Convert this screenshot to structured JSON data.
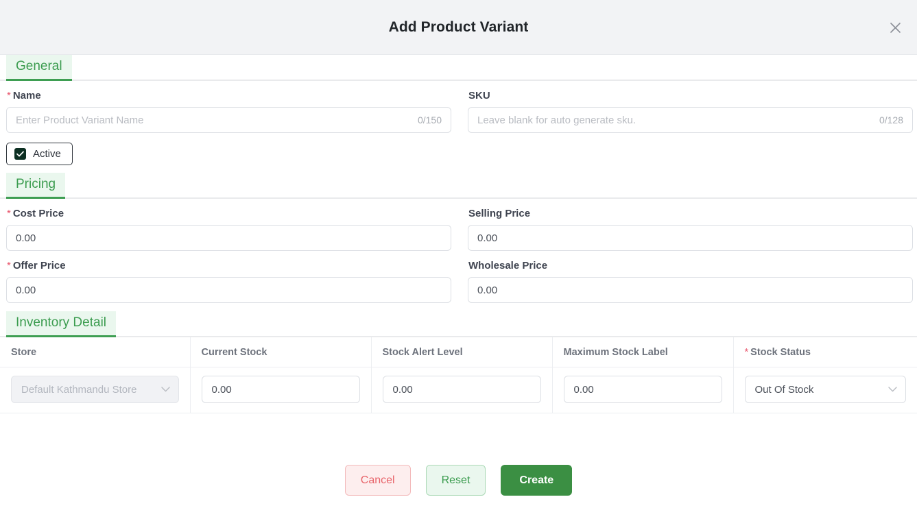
{
  "header": {
    "title": "Add Product Variant",
    "close_icon": "close-icon"
  },
  "sections": {
    "general": {
      "tab_label": "General",
      "name": {
        "label": "Name",
        "required": true,
        "required_mark": "*",
        "placeholder": "Enter Product Variant Name",
        "value": "",
        "counter": "0/150"
      },
      "sku": {
        "label": "SKU",
        "required": false,
        "placeholder": "Leave blank for auto generate sku.",
        "value": "",
        "counter": "0/128"
      },
      "active": {
        "label": "Active",
        "checked": true,
        "icon": "check-icon"
      }
    },
    "pricing": {
      "tab_label": "Pricing",
      "cost_price": {
        "label": "Cost Price",
        "required": true,
        "required_mark": "*",
        "value": "0.00"
      },
      "selling_price": {
        "label": "Selling Price",
        "required": false,
        "value": "0.00"
      },
      "offer_price": {
        "label": "Offer Price",
        "required": true,
        "required_mark": "*",
        "value": "0.00"
      },
      "wholesale_price": {
        "label": "Wholesale Price",
        "required": false,
        "value": "0.00"
      }
    },
    "inventory": {
      "tab_label": "Inventory Detail",
      "columns": [
        {
          "label": "Store",
          "required": false,
          "required_mark": ""
        },
        {
          "label": "Current Stock",
          "required": false,
          "required_mark": ""
        },
        {
          "label": "Stock Alert Level",
          "required": false,
          "required_mark": ""
        },
        {
          "label": "Maximum Stock Label",
          "required": false,
          "required_mark": ""
        },
        {
          "label": "Stock Status",
          "required": true,
          "required_mark": "*"
        }
      ],
      "rows": [
        {
          "store": {
            "value": "Default Kathmandu Store",
            "disabled": true,
            "icon": "chevron-down-icon"
          },
          "current_stock": {
            "value": "0.00"
          },
          "stock_alert_level": {
            "value": "0.00"
          },
          "maximum_stock_label": {
            "value": "0.00"
          },
          "stock_status": {
            "value": "Out Of Stock",
            "icon": "chevron-down-icon"
          }
        }
      ]
    }
  },
  "footer": {
    "cancel_label": "Cancel",
    "reset_label": "Reset",
    "create_label": "Create"
  },
  "colors": {
    "accent_green": "#3b9c4f",
    "primary_button": "#3b8f43",
    "danger": "#e8646a",
    "required_star": "#e8546b",
    "header_bg": "#f2f3f5",
    "tab_bg": "#eaf7ee"
  }
}
